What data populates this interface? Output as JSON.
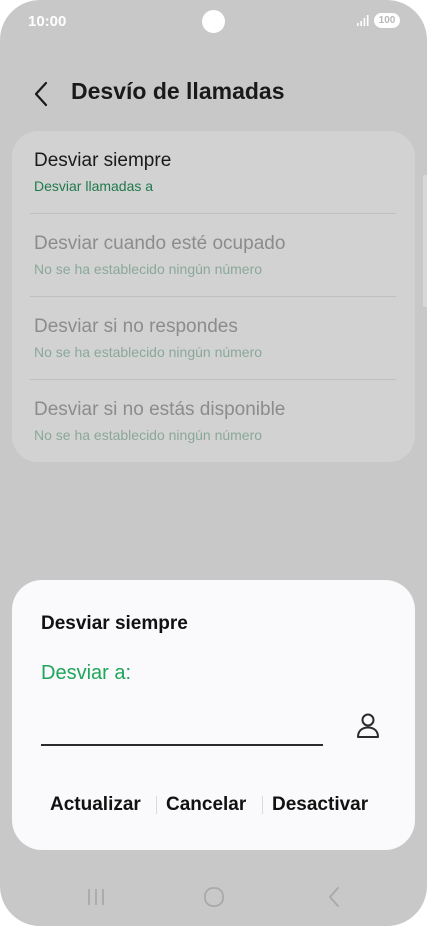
{
  "status_bar": {
    "time": "10:00",
    "battery": "100"
  },
  "header": {
    "title": "Desvío de llamadas"
  },
  "forward_options": [
    {
      "title": "Desviar siempre",
      "subtitle": "Desviar llamadas a",
      "enabled": true
    },
    {
      "title": "Desviar cuando esté ocupado",
      "subtitle": "No se ha establecido ningún número",
      "enabled": false
    },
    {
      "title": "Desviar si no respondes",
      "subtitle": "No se ha establecido ningún número",
      "enabled": false
    },
    {
      "title": "Desviar si no estás disponible",
      "subtitle": "No se ha establecido ningún número",
      "enabled": false
    }
  ],
  "dialog": {
    "title": "Desviar siempre",
    "label": "Desviar a:",
    "number_value": "",
    "buttons": {
      "update": "Actualizar",
      "cancel": "Cancelar",
      "disable": "Desactivar"
    }
  },
  "icons": {
    "back": "chevron-left-icon",
    "contact": "person-icon",
    "nav_recents": "recents-icon",
    "nav_home": "home-icon",
    "nav_back": "back-icon"
  },
  "colors": {
    "accent_green": "#1da55a",
    "dim_overlay": "#c8c8c8",
    "dialog_bg": "#fafafc"
  }
}
